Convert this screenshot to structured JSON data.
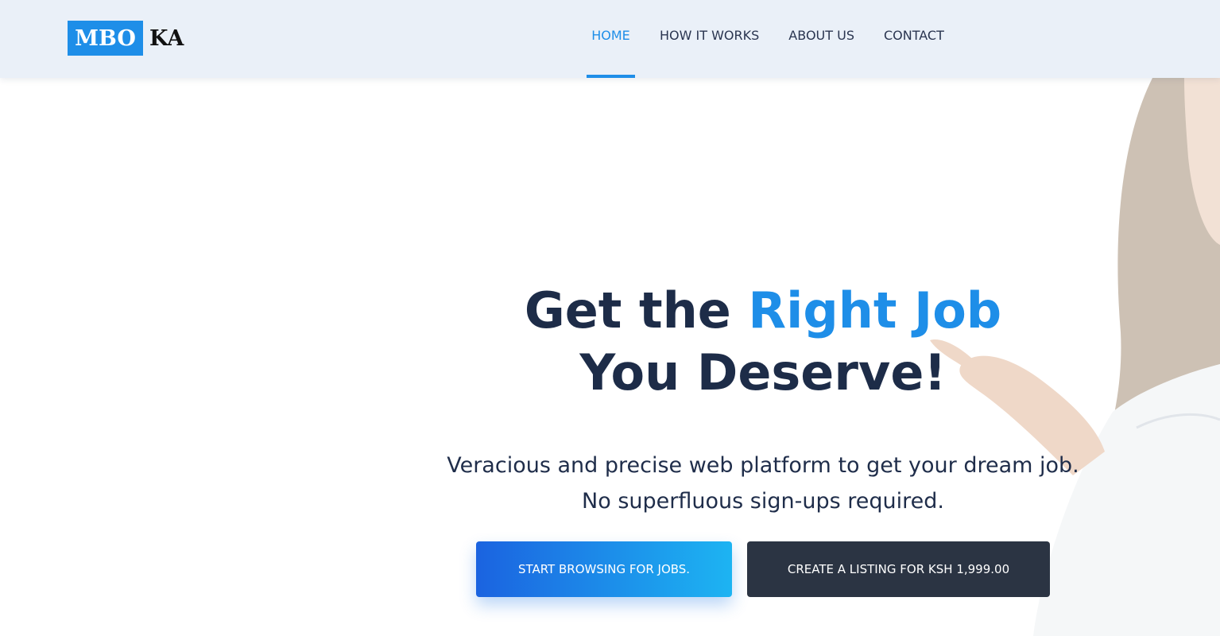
{
  "brand": {
    "logo_part1": "MBO",
    "logo_part2": "KA",
    "accent_color": "#1e8ee8"
  },
  "nav": {
    "items": [
      {
        "label": "HOME",
        "active": true
      },
      {
        "label": "HOW IT WORKS",
        "active": false
      },
      {
        "label": "ABOUT US",
        "active": false
      },
      {
        "label": "CONTACT",
        "active": false
      }
    ]
  },
  "hero": {
    "title_before": "Get the ",
    "title_accent": "Right Job",
    "title_line2": "You Deserve!",
    "subtitle": "Veracious and precise web platform to get your dream job. No superfluous sign-ups required.",
    "primary_cta": "START BROWSING FOR JOBS.",
    "secondary_cta": "CREATE A LISTING FOR KSH 1,999.00",
    "background_image": "woman-pointing-photo"
  }
}
